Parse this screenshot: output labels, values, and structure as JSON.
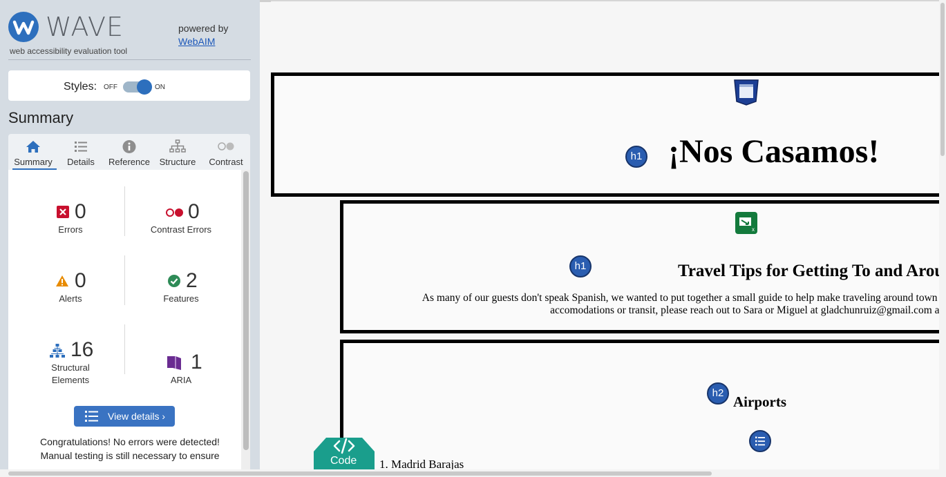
{
  "sidebar": {
    "logo_text": "WAVE",
    "tagline": "web accessibility evaluation tool",
    "powered_by": "powered by",
    "webaim_link": "WebAIM",
    "styles_label": "Styles:",
    "styles_off": "OFF",
    "styles_on": "ON",
    "styles_enabled": true,
    "summary_title": "Summary",
    "tabs": [
      {
        "label": "Summary",
        "icon": "home-icon",
        "active": true
      },
      {
        "label": "Details",
        "icon": "list-icon",
        "active": false
      },
      {
        "label": "Reference",
        "icon": "info-icon",
        "active": false
      },
      {
        "label": "Structure",
        "icon": "hierarchy-icon",
        "active": false
      },
      {
        "label": "Contrast",
        "icon": "contrast-icon",
        "active": false
      }
    ],
    "stats": {
      "errors": {
        "value": "0",
        "label": "Errors"
      },
      "contrast_errors": {
        "value": "0",
        "label": "Contrast Errors"
      },
      "alerts": {
        "value": "0",
        "label": "Alerts"
      },
      "features": {
        "value": "2",
        "label": "Features"
      },
      "structural": {
        "value": "16",
        "label_line1": "Structural",
        "label_line2": "Elements"
      },
      "aria": {
        "value": "1",
        "label": "ARIA"
      }
    },
    "view_details": "View details ›",
    "congrats_line1": "Congratulations! No errors were detected!",
    "congrats_line2": "Manual testing is still necessary to ensure"
  },
  "page": {
    "main_heading": "¡Nos Casamos!",
    "main_badge": "h1",
    "travel_heading": "Travel Tips for Getting To and Around Madrid",
    "travel_badge": "h1",
    "intro_line1": "As many of our guests don't speak Spanish, we wanted to put together a small guide to help make traveling around town as eas",
    "intro_line2": "accomodations or transit, please reach out to Sara or Miguel at gladchunruiz@gmail.com and we",
    "airports_heading": "Airports",
    "airports_badge": "h2",
    "list_item_1": "1. Madrid Barajas",
    "code_tab": "Code"
  },
  "colors": {
    "accent": "#2d6fbd",
    "error": "#c8102e",
    "alert": "#e88b00",
    "feature": "#2e8b57",
    "aria": "#6a2c91",
    "code_tab": "#1a9e8c"
  }
}
